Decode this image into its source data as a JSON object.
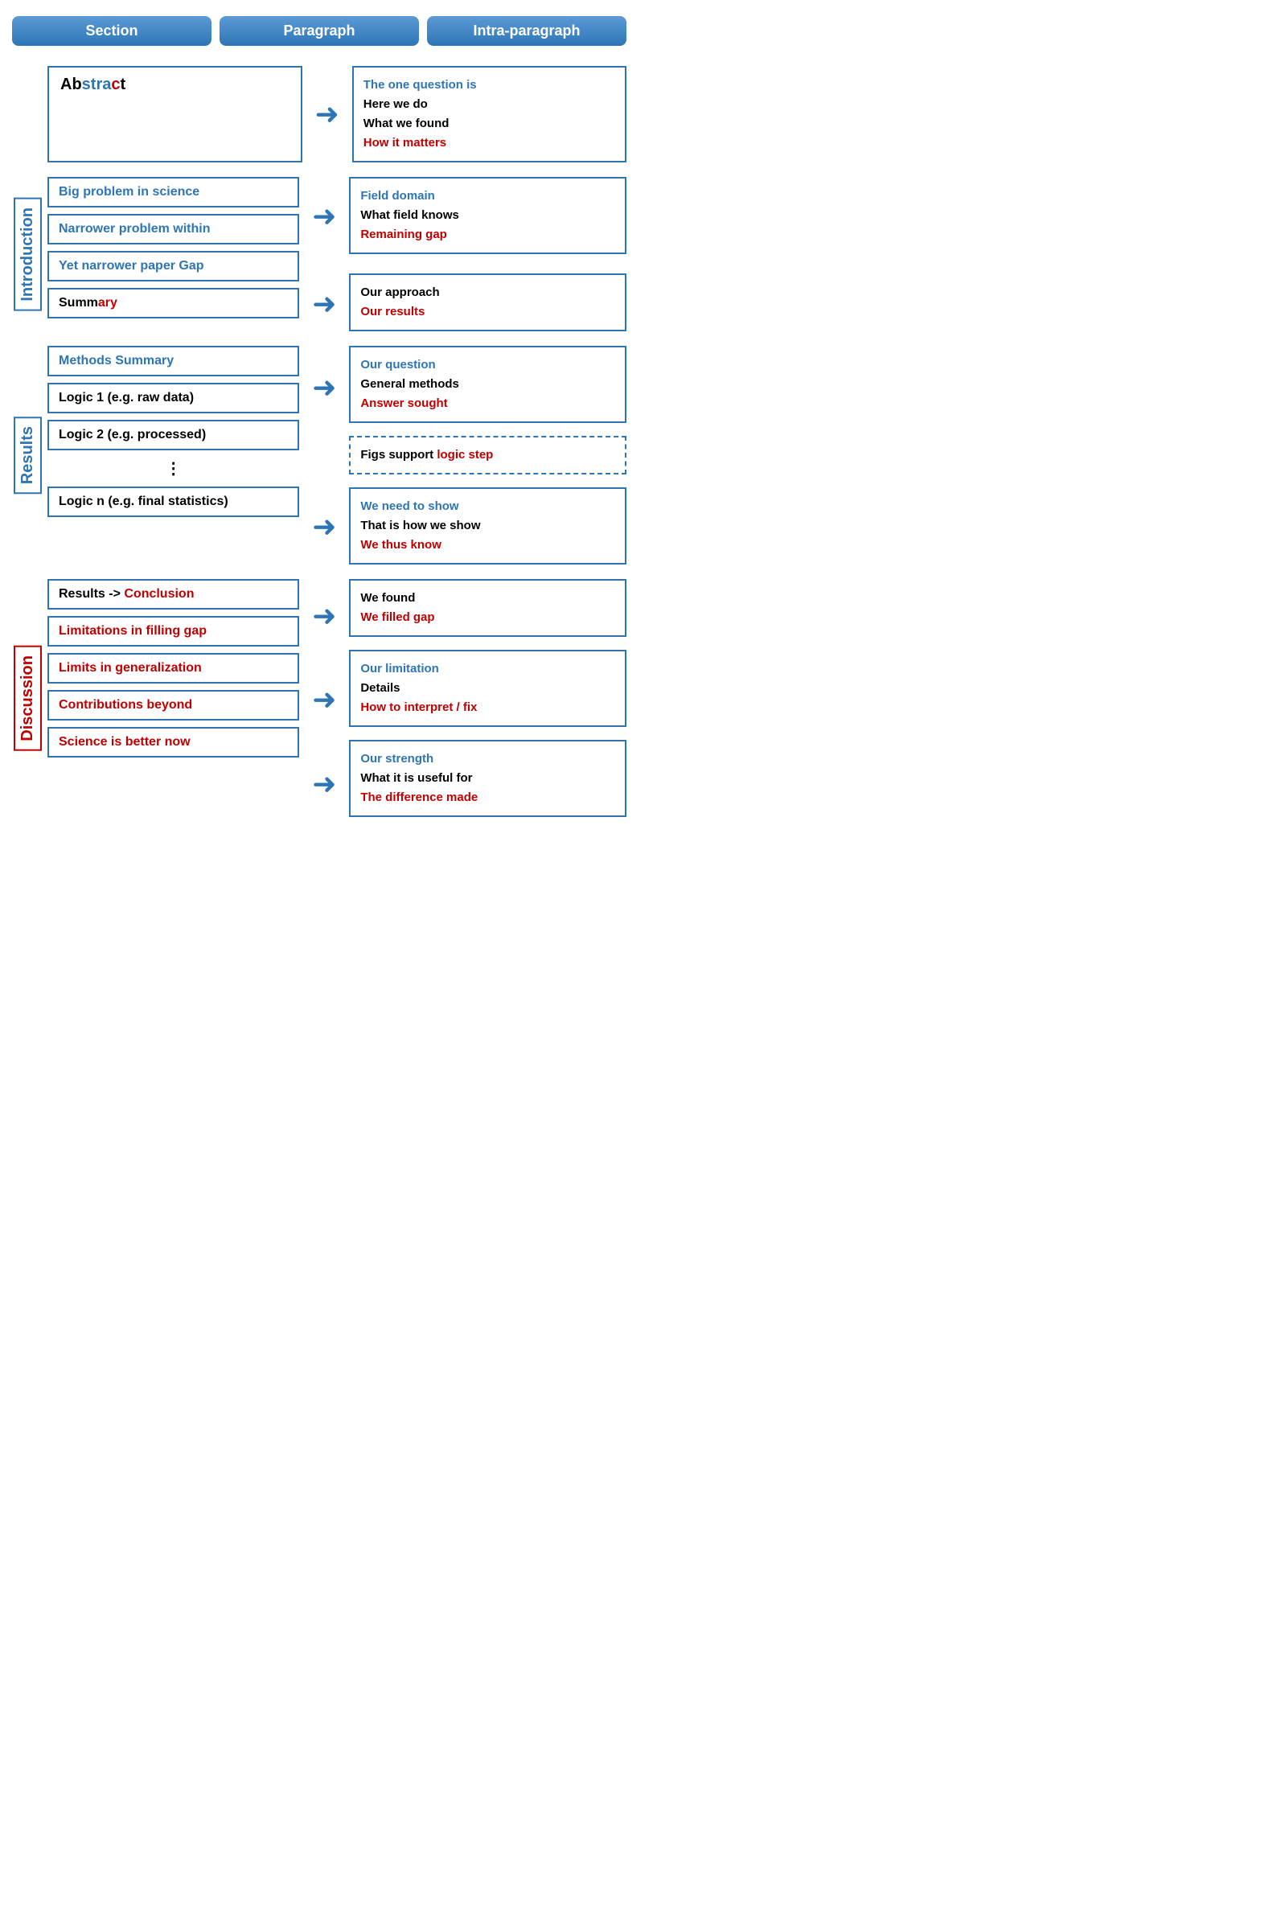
{
  "header": {
    "col1": "Section",
    "col2": "Paragraph",
    "col3": "Intra-paragraph"
  },
  "abstract": {
    "para_label_prefix": "Ab",
    "para_label_bold_blue": "stra",
    "para_label_red": "c",
    "para_label_end": "t",
    "intra": {
      "line1": "The one question is",
      "line2": "Here we do",
      "line3": "What we found",
      "line4": "How it matters"
    }
  },
  "introduction": {
    "section_label": "Introduction",
    "paragraphs": [
      {
        "text": "Big problem in science",
        "color": "blue"
      },
      {
        "text": "Narrower problem within",
        "color": "blue"
      },
      {
        "text": "Yet narrower paper Gap",
        "color": "blue"
      },
      {
        "text": "Summary",
        "color": "black-red",
        "prefix": "Summ",
        "red": "ary"
      }
    ],
    "intra_boxes": [
      {
        "lines": [
          {
            "text": "Field domain",
            "color": "blue"
          },
          {
            "text": "What field knows",
            "color": "black"
          },
          {
            "text": "Remaining gap",
            "color": "red"
          }
        ]
      },
      {
        "lines": [
          {
            "text": "Our approach",
            "color": "black"
          },
          {
            "text": "Our results",
            "color": "red"
          }
        ]
      }
    ]
  },
  "results": {
    "section_label": "Results",
    "paragraphs": [
      {
        "text": "Methods Summary",
        "color": "blue"
      },
      {
        "text": "Logic 1 (e.g. raw data)",
        "color": "black"
      },
      {
        "text": "Logic 2 (e.g. processed)",
        "color": "black"
      },
      {
        "text": "Logic n (e.g. final statistics)",
        "color": "black"
      }
    ],
    "intra_boxes": [
      {
        "lines": [
          {
            "text": "Our question",
            "color": "blue"
          },
          {
            "text": "General methods",
            "color": "black"
          },
          {
            "text": "Answer sought",
            "color": "red"
          }
        ]
      },
      {
        "dashed": true,
        "lines": [
          {
            "text": "Figs support ",
            "color": "black",
            "inline_red": "logic step"
          }
        ]
      },
      {
        "lines": [
          {
            "text": "We need to show",
            "color": "blue"
          },
          {
            "text": "That is how we show",
            "color": "black"
          },
          {
            "text": "We thus know",
            "color": "red"
          }
        ]
      }
    ]
  },
  "discussion": {
    "section_label": "Discussion",
    "paragraphs": [
      {
        "text_prefix": "Results -> ",
        "text_red": "Conclusion",
        "color": "mixed"
      },
      {
        "text": "Limitations in filling gap",
        "color": "red"
      },
      {
        "text": "Limits in generalization",
        "color": "red"
      },
      {
        "text": "Contributions beyond",
        "color": "red"
      },
      {
        "text": "Science is better now",
        "color": "red"
      }
    ],
    "intra_boxes": [
      {
        "lines": [
          {
            "text": "We found",
            "color": "black"
          },
          {
            "text": "We filled gap",
            "color": "red"
          }
        ]
      },
      {
        "lines": [
          {
            "text": "Our limitation",
            "color": "blue"
          },
          {
            "text": "Details",
            "color": "black"
          },
          {
            "text": "How to interpret / fix",
            "color": "red"
          }
        ]
      },
      {
        "lines": [
          {
            "text": "Our strength",
            "color": "blue"
          },
          {
            "text": "What it is useful for",
            "color": "black"
          },
          {
            "text": "The difference made",
            "color": "red"
          }
        ]
      }
    ]
  }
}
